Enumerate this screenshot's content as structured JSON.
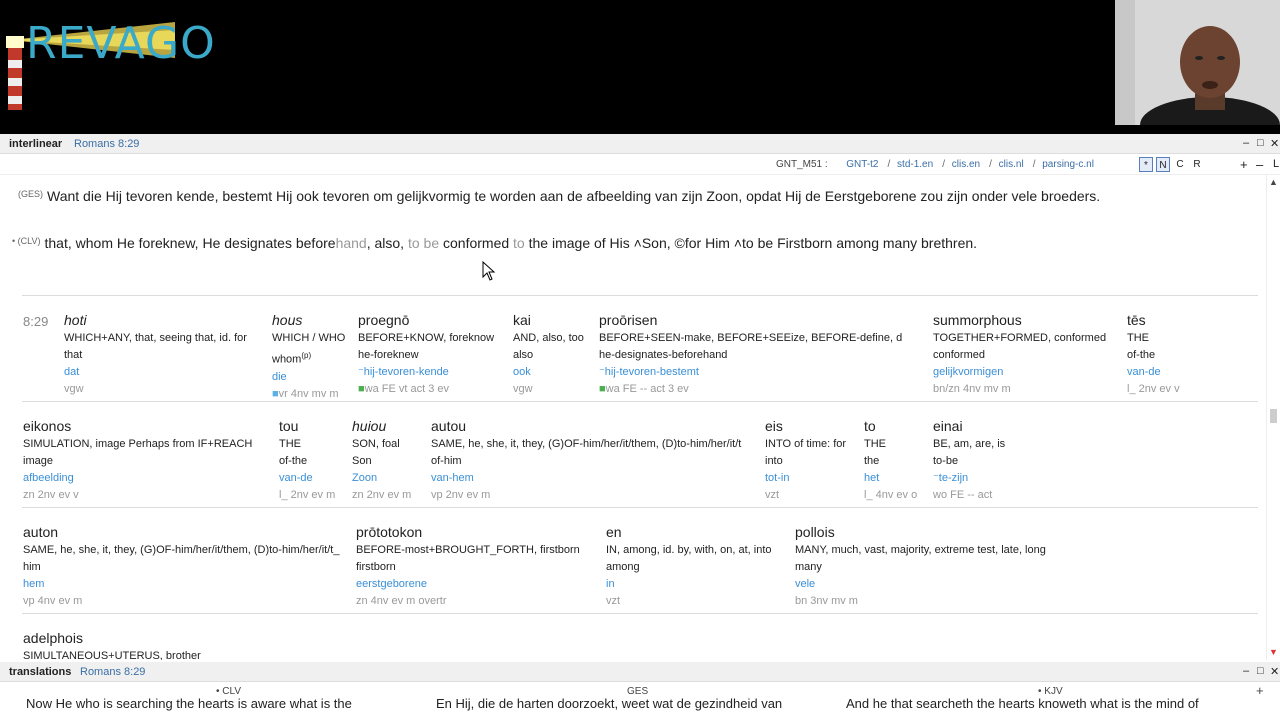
{
  "logo": {
    "text": "REVAGO"
  },
  "interlinear": {
    "title": "interlinear",
    "reference": "Romans 8:29",
    "modules": [
      "GNT_M51 :",
      "GNT-t2",
      "std-1.en",
      "clis.en",
      "clis.nl",
      "parsing-c.nl"
    ],
    "toggles": [
      "*",
      "N",
      "C",
      "R"
    ],
    "ges_tag": "(GES)",
    "ges_text": "Want die Hij tevoren kende, bestemt Hij ook tevoren om gelijkvormig te worden aan de afbeelding van zijn Zoon, opdat Hij de Eerstgeborene zou zijn onder vele broeders.",
    "clv_tag": "• (CLV)",
    "clv_parts": {
      "a": "that, whom He foreknew, He designates before",
      "b": "hand",
      "c": ", also, ",
      "d": "to be",
      "e": " conformed ",
      "f": "to",
      "g": " the image of His ",
      "h": "˄Son, ",
      "i": "©for Him ˄to be Firstborn among many brethren."
    },
    "verse_number": "8:29",
    "words": [
      {
        "gk": "hoti",
        "en1": "WHICH+ANY, that, seeing that,  id. for",
        "en2": "that",
        "nl": "dat",
        "parse": "vgw"
      },
      {
        "gk": "hous",
        "en1": "WHICH / WHO",
        "en2": "whom",
        "nl": "die",
        "parse": "vr 4nv mv m"
      },
      {
        "gk": "proegnō",
        "en1": "BEFORE+KNOW, foreknow",
        "en2": "he-foreknew",
        "nl": "⁻hij-tevoren-kende",
        "parse": "wa FE vt act 3 ev"
      },
      {
        "gk": "kai",
        "en1": "AND, also, too",
        "en2": "also",
        "nl": "ook",
        "parse": "vgw"
      },
      {
        "gk": "proōrisen",
        "en1": "BEFORE+SEEN-make, BEFORE+SEEize, BEFORE-define, d",
        "en2": "he-designates-beforehand",
        "nl": "⁻hij-tevoren-bestemt",
        "parse": "wa FE -- act 3 ev"
      },
      {
        "gk": "summorphous",
        "en1": "TOGETHER+FORMED, conformed",
        "en2": "conformed",
        "nl": "gelijkvormigen",
        "parse": "bn/zn 4nv mv m"
      },
      {
        "gk": "tēs",
        "en1": "THE",
        "en2": "of-the",
        "nl": "van-de",
        "parse": "l_ 2nv ev v"
      },
      {
        "gk": "eikonos",
        "en1": "SIMULATION, image  Perhaps from IF+REACH",
        "en2": "image",
        "nl": "afbeelding",
        "parse": "zn 2nv ev v"
      },
      {
        "gk": "tou",
        "en1": "THE",
        "en2": "of-the",
        "nl": "van-de",
        "parse": "l_ 2nv ev m"
      },
      {
        "gk": "huiou",
        "en1": "SON, foal",
        "en2": "Son",
        "nl": "Zoon",
        "parse": "zn 2nv ev m"
      },
      {
        "gk": "autou",
        "en1": "SAME, he, she, it, they, (G)OF-him/her/it/them, (D)to-him/her/it/t",
        "en2": "of-him",
        "nl": "van-hem",
        "parse": "vp 2nv ev m"
      },
      {
        "gk": "eis",
        "en1": "INTO  of time: for",
        "en2": "into",
        "nl": "tot-in",
        "parse": "vzt"
      },
      {
        "gk": "to",
        "en1": "THE",
        "en2": "the",
        "nl": "het",
        "parse": "l_ 4nv ev o"
      },
      {
        "gk": "einai",
        "en1": "BE, am, are, is",
        "en2": "to-be",
        "nl": "⁻te-zijn",
        "parse": "wo FE -- act"
      },
      {
        "gk": "auton",
        "en1": "SAME, he, she, it, they, (G)OF-him/her/it/them, (D)to-him/her/it/t_",
        "en2": "him",
        "nl": "hem",
        "parse": "vp 4nv ev m"
      },
      {
        "gk": "prōtotokon",
        "en1": "BEFORE-most+BROUGHT_FORTH, firstborn",
        "en2": "firstborn",
        "nl": "eerstgeborene",
        "parse": "zn 4nv ev m overtr"
      },
      {
        "gk": "en",
        "en1": "IN, among,  id. by, with, on, at, into",
        "en2": "among",
        "nl": "in",
        "parse": "vzt"
      },
      {
        "gk": "pollois",
        "en1": "MANY, much, vast, majority, extreme test, late, long",
        "en2": "many",
        "nl": "vele",
        "parse": "bn 3nv mv m"
      },
      {
        "gk": "adelphois",
        "en1": "SIMULTANEOUS+UTERUS, brother",
        "en2": "",
        "nl": "",
        "parse": ""
      }
    ]
  },
  "translations": {
    "title": "translations",
    "reference": "Romans 8:29",
    "columns": [
      "• CLV",
      "GES",
      "• KJV"
    ],
    "texts": [
      "Now He who is searching the hearts is aware what is the",
      "En Hij, die de harten doorzoekt, weet wat de gezindheid van",
      "And he that searcheth the hearts knoweth what is the mind of"
    ]
  }
}
